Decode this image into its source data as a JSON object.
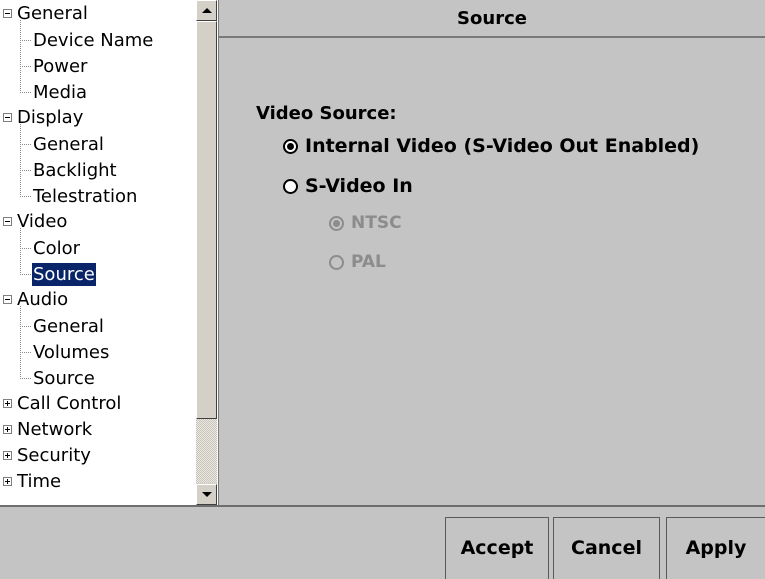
{
  "tree": {
    "rows": [
      {
        "label": "General",
        "kind": "parent",
        "expander": "minus"
      },
      {
        "label": "Device Name",
        "kind": "child"
      },
      {
        "label": "Power",
        "kind": "child"
      },
      {
        "label": "Media",
        "kind": "child"
      },
      {
        "label": "Display",
        "kind": "parent",
        "expander": "minus"
      },
      {
        "label": "General",
        "kind": "child"
      },
      {
        "label": "Backlight",
        "kind": "child"
      },
      {
        "label": "Telestration",
        "kind": "child"
      },
      {
        "label": "Video",
        "kind": "parent",
        "expander": "minus"
      },
      {
        "label": "Color",
        "kind": "child"
      },
      {
        "label": "Source",
        "kind": "child",
        "selected": true
      },
      {
        "label": "Audio",
        "kind": "parent",
        "expander": "minus"
      },
      {
        "label": "General",
        "kind": "child"
      },
      {
        "label": "Volumes",
        "kind": "child"
      },
      {
        "label": "Source",
        "kind": "child"
      },
      {
        "label": "Call Control",
        "kind": "parent",
        "expander": "plus"
      },
      {
        "label": "Network",
        "kind": "parent",
        "expander": "plus"
      },
      {
        "label": "Security",
        "kind": "parent",
        "expander": "plus"
      },
      {
        "label": "Time",
        "kind": "parent",
        "expander": "plus"
      }
    ]
  },
  "content": {
    "title": "Source",
    "group_label": "Video Source:",
    "options": [
      {
        "label": "Internal Video (S-Video Out Enabled)",
        "checked": true,
        "disabled": false
      },
      {
        "label": "S-Video In",
        "checked": false,
        "disabled": false
      }
    ],
    "sub_options": [
      {
        "label": "NTSC",
        "checked": true,
        "disabled": true
      },
      {
        "label": "PAL",
        "checked": false,
        "disabled": true
      }
    ]
  },
  "buttons": {
    "accept": "Accept",
    "cancel": "Cancel",
    "apply": "Apply"
  },
  "colors": {
    "selection_bg": "#0a246a",
    "panel_bg": "#c4c4c4",
    "disabled_text": "#8c8c8c"
  }
}
